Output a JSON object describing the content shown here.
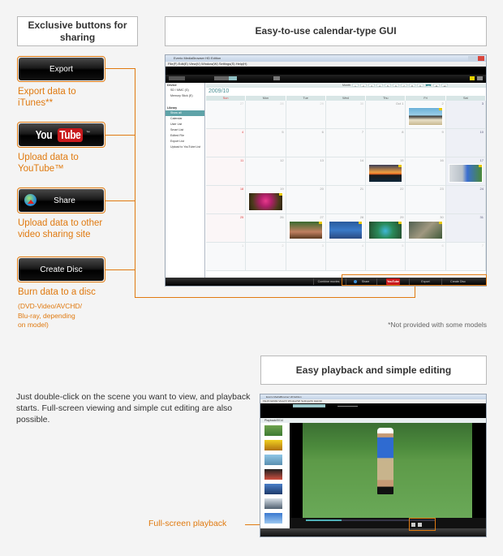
{
  "sharing": {
    "title": "Exclusive buttons for sharing",
    "buttons": [
      {
        "label": "Export",
        "description": [
          "Export data to",
          "iTunes**"
        ]
      },
      {
        "label_you": "You",
        "label_tube": "Tube",
        "label_tm": "™",
        "description": [
          "Upload data to",
          "YouTube™"
        ]
      },
      {
        "label": "Share",
        "description": [
          "Upload data to other",
          "video sharing site"
        ]
      },
      {
        "label": "Create Disc",
        "description": [
          "Burn data to a disc"
        ],
        "note": [
          "(DVD-Video/AVCHD/",
          "Blu-ray, depending",
          "on model)"
        ]
      }
    ]
  },
  "calendar_section": {
    "title": "Easy-to-use calendar-type GUI",
    "window": {
      "title": "Everio MediaBrowser HD Edition",
      "menu": "File(F)  Edit(E)  View(V)  Window(W)  Settings(S)  Help(H)",
      "sidebar": {
        "device_header": "Device",
        "devices": [
          "SD / MMC (G)",
          "Memory Stick (E)"
        ],
        "library_header": "Library",
        "library_items": [
          "Show all",
          "Calendar",
          "User List",
          "Smart List",
          "Edited File",
          "Export List",
          "Upload to YouTube List"
        ]
      },
      "month_label": "Month",
      "months": [
        "1",
        "2",
        "3",
        "4",
        "5",
        "6",
        "7",
        "8",
        "9",
        "10",
        "11",
        "12"
      ],
      "selected_month": "10",
      "year_month": "2009/10",
      "weekdays": [
        "Sun",
        "Mon",
        "Tue",
        "Wed",
        "Thu",
        "Fri",
        "Sat"
      ],
      "days": [
        [
          "27",
          "28",
          "29",
          "30",
          "Oct 1",
          "2",
          "3"
        ],
        [
          "4",
          "5",
          "6",
          "7",
          "8",
          "9",
          "10"
        ],
        [
          "11",
          "12",
          "13",
          "14",
          "15",
          "16",
          "17"
        ],
        [
          "18",
          "19",
          "20",
          "21",
          "22",
          "23",
          "24"
        ],
        [
          "25",
          "26",
          "27",
          "28",
          "29",
          "30",
          "31"
        ],
        [
          "1",
          "2",
          "3",
          "4",
          "5",
          "6",
          "7"
        ]
      ],
      "bottom_buttons": [
        "Combine movies",
        "Share",
        "YouTube",
        "Export",
        "Create Disc"
      ]
    },
    "footnote": "*Not provided with some models"
  },
  "playback_section": {
    "title": "Easy playback and simple editing",
    "description": "Just double-click on the scene you want to view, and playback starts. Full-screen viewing and simple cut editing are also possible.",
    "callout": "Full-screen playback",
    "window": {
      "title": "Everio MediaBrowser HD Edition",
      "menu": "File(F)  Edit(E)  View(V)  Window(W)  Settings(S)  Help(H)",
      "breadcrumb": "Playback/0014"
    }
  },
  "colors": {
    "accent": "#e07a10",
    "calendar_teal": "#5fa3a8",
    "youtube_red": "#c9191c"
  }
}
